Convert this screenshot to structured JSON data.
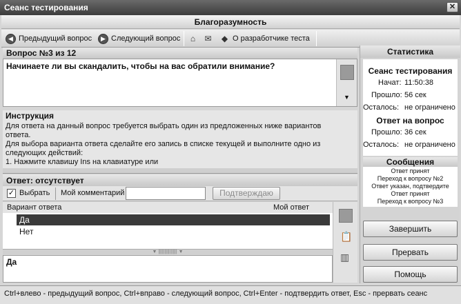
{
  "window": {
    "title": "Сеанс тестирования",
    "close_glyph": "✕"
  },
  "banner": "Благоразумность",
  "toolbar": {
    "prev_label": "Предыдущий вопрос",
    "next_label": "Следующий вопрос",
    "about_label": "О разработчике теста"
  },
  "question": {
    "header": "Вопрос №3 из 12",
    "text": "Начинаете ли вы скандалить, чтобы на вас обратили внимание?"
  },
  "instruction": {
    "title": "Инструкция",
    "lines": [
      "Для ответа на данный вопрос требуется выбрать один из предложенных ниже вариантов",
      "ответа.",
      "Для выбора варианта ответа сделайте его запись в списке текущей и выполните одно из",
      "следующих действий:",
      "1. Нажмите клавишу Ins на клавиатуре или"
    ]
  },
  "answer": {
    "header": "Ответ: отсутствует",
    "choose_label": "Выбрать",
    "choose_checked": true,
    "comment_label": "Мой комментарий",
    "comment_value": "",
    "confirm_label": "Подтверждаю",
    "col_variant": "Вариант ответа",
    "col_my": "Мой ответ",
    "options": [
      "Да",
      "Нет"
    ],
    "selected_index": 0,
    "selected_text": "Да"
  },
  "stats": {
    "header": "Статистика",
    "session_title": "Сеанс тестирования",
    "start_label": "Начат:",
    "start_value": "11:50:38",
    "elapsed_label": "Прошло:",
    "elapsed_value": "56 сек",
    "left_label": "Осталось:",
    "left_value": "не ограничено",
    "qa_title": "Ответ на вопрос",
    "q_elapsed_label": "Прошло:",
    "q_elapsed_value": "36 сек",
    "q_left_label": "Осталось:",
    "q_left_value": "не ограничено"
  },
  "messages": {
    "header": "Сообщения",
    "items": [
      "Ответ принят",
      "Переход к вопросу №2",
      "Ответ указан, подтвердите",
      "Ответ принят",
      "Переход к вопросу №3"
    ]
  },
  "side_buttons": {
    "finish": "Завершить",
    "interrupt": "Прервать",
    "help": "Помощь"
  },
  "statusbar": "Ctrl+влево - предыдущий вопрос, Ctrl+вправо - следующий вопрос, Ctrl+Enter - подтвердить ответ, Esc - прервать сеанс"
}
